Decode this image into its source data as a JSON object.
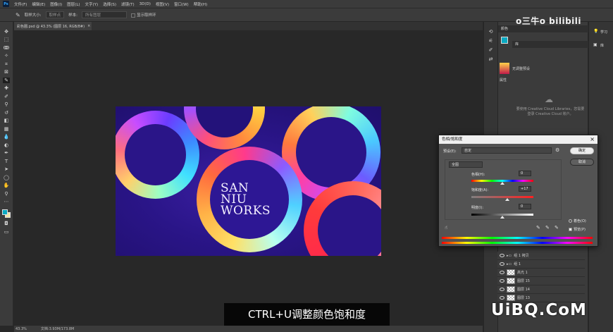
{
  "menu": {
    "items": [
      "文件(F)",
      "编辑(E)",
      "图像(I)",
      "图层(L)",
      "文字(Y)",
      "选择(S)",
      "滤镜(T)",
      "3D(D)",
      "视图(V)",
      "窗口(W)",
      "帮助(H)"
    ]
  },
  "options": {
    "sample_size_label": "取样大小:",
    "sample_size_value": "取样点",
    "sample_label": "样本:",
    "sample_value": "所有图层",
    "ring_label": "显示取样环"
  },
  "document": {
    "tab_label": "彩色圈.psd @ 43.3% (图层 16, RGB/8#)",
    "artwork_lines": [
      "SAN",
      "NIU",
      "WORKS"
    ]
  },
  "status": {
    "zoom": "43.3%",
    "doc_size": "文档:3.93M/173.8M"
  },
  "panels": {
    "color_tab": "颜色",
    "library_tab": "库",
    "adjustments_tab": "调整",
    "properties_tab": "属性",
    "preset_label": "无调整预设",
    "cc_notice": "要使用 Creative Cloud Libraries，您需要登录 Creative Cloud 账户。",
    "learn_label": "学习",
    "library_label": "库"
  },
  "layers": [
    {
      "name": "组 1 拷贝"
    },
    {
      "name": "组 1"
    },
    {
      "name": "高光 1"
    },
    {
      "name": "图层 15"
    },
    {
      "name": "图层 14"
    },
    {
      "name": "图层 13"
    }
  ],
  "dialog": {
    "title": "色相/饱和度",
    "preset_label": "预设(E):",
    "preset_value": "自定",
    "channel_value": "全图",
    "hue_label": "色相(H):",
    "hue_value": "0",
    "saturation_label": "饱和度(A):",
    "saturation_value": "+17",
    "lightness_label": "明度(I):",
    "lightness_value": "0",
    "ok_label": "确定",
    "cancel_label": "取消",
    "colorize_label": "着色(O)",
    "preview_label": "预览(P)",
    "saturation_level": 17
  },
  "subtitle": "CTRL+U调整颜色饱和度",
  "watermarks": {
    "top": "o三牛o bilibili",
    "bottom": "UiBQ.CoM"
  },
  "colors": {
    "foreground": "#0aa9c1",
    "background": "#efe2a6",
    "canvas_bg": "#2a1588"
  }
}
